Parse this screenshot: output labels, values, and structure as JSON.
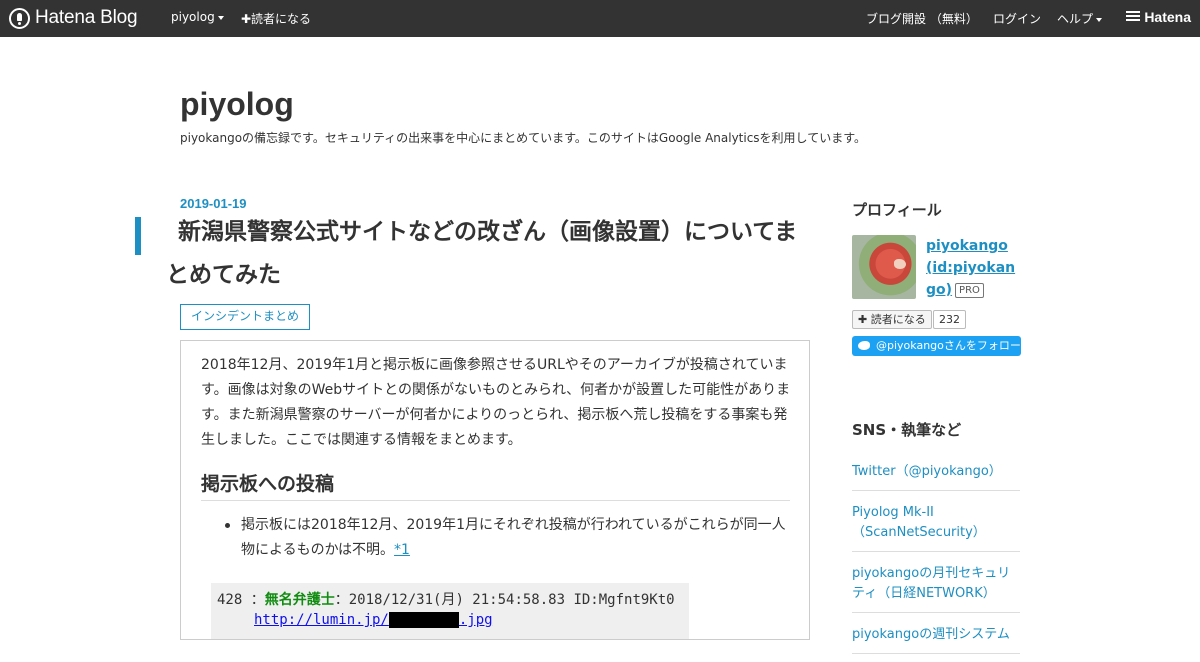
{
  "global_header": {
    "logo_text": "Hatena Blog",
    "blog_menu": "piyolog",
    "subscribe": "✚読者になる",
    "open_blog": "ブログ開設 （無料）",
    "login": "ログイン",
    "help": "ヘルプ",
    "brand": "Hatena"
  },
  "blog": {
    "title": "piyolog",
    "description": "piyokangoの備忘録です。セキュリティの出来事を中心にまとめています。このサイトはGoogle Analyticsを利用しています。"
  },
  "entry": {
    "date": "2019-01-19",
    "title": "新潟県警察公式サイトなどの改ざん（画像設置）についてまとめてみた",
    "category": "インシデントまとめ",
    "intro": "2018年12月、2019年1月と掲示板に画像参照させるURLやそのアーカイブが投稿されています。画像は対象のWebサイトとの関係がないものとみられ、何者かが設置した可能性があります。また新潟県警察のサーバーが何者かによりのっとられ、掲示板へ荒し投稿をする事案も発生しました。ここでは関連する情報をまとめます。",
    "section_heading": "掲示板への投稿",
    "bullet_text": "掲示板には2018年12月、2019年1月にそれぞれ投稿が行われているがこれらが同一人物によるものかは不明。",
    "footnote": "*1",
    "image_post": {
      "number": "428",
      "separator": "：",
      "name": "無名弁護士",
      "meta": "：2018/12/31(月) 21:54:58.83 ID:Mgfnt9Kt0",
      "link_prefix": "http://lumin.jp/",
      "link_suffix": ".jpg"
    }
  },
  "sidebar": {
    "profile_heading": "プロフィール",
    "profile_name": "piyokango (id:piyokango)",
    "pro_badge": "PRO",
    "reader_button": "✚ 読者になる",
    "reader_count": "232",
    "twitter_follow": "@piyokangoさんをフォロー",
    "sns_heading": "SNS・執筆など",
    "sns_links": [
      "Twitter（@piyokango）",
      "Piyolog Mk-II（ScanNetSecurity）",
      "piyokangoの月刊セキュリティ（日経NETWORK）",
      "piyokangoの週刊システム"
    ]
  },
  "colors": {
    "header_bg": "#333333",
    "accent": "#1e8fc2",
    "twitter": "#1da1f2"
  }
}
